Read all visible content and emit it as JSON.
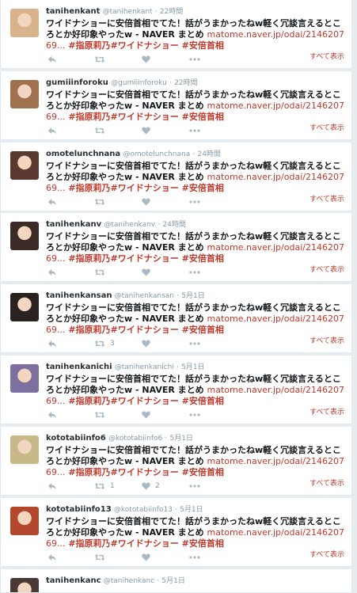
{
  "tweets": [
    {
      "name": "tanihenkant",
      "handle": "@tanihenkant",
      "sep": "·",
      "time": "22時間",
      "text": "ワイドナショーに安倍首相でてた！話がうまかったねw軽く冗談言えるところとか好印象やったw - NAVER まとめ ",
      "link": "matome.naver.jp/odai/214620769...",
      "tags": "#指原莉乃#ワイドナショー #安倍首相",
      "retweets": "",
      "likes": "",
      "show_all": "すべて表示",
      "avatar_color": "#d9b38c"
    },
    {
      "name": "gumiiinforoku",
      "handle": "@gumiiinforoku",
      "sep": "·",
      "time": "22時間",
      "text": "ワイドナショーに安倍首相でてた！話がうまかったねw軽く冗談言えるところとか好印象やったw - NAVER まとめ ",
      "link": "matome.naver.jp/odai/214620769...",
      "tags": "#指原莉乃#ワイドナショー #安倍首相",
      "retweets": "",
      "likes": "",
      "show_all": "すべて表示",
      "avatar_color": "#a0714f"
    },
    {
      "name": "omotelunchnana",
      "handle": "@omotelunchnana",
      "sep": "·",
      "time": "24時間",
      "text": "ワイドナショーに安倍首相でてた！話がうまかったねw軽く冗談言えるところとか好印象やったw - NAVER まとめ ",
      "link": "matome.naver.jp/odai/214620769...",
      "tags": "#指原莉乃#ワイドナショー #安倍首相",
      "retweets": "",
      "likes": "",
      "show_all": "すべて表示",
      "avatar_color": "#5a3a30"
    },
    {
      "name": "tanihenkanv",
      "handle": "@tanihenkanv",
      "sep": "·",
      "time": "24時間",
      "text": "ワイドナショーに安倍首相でてた！話がうまかったねw軽く冗談言えるところとか好印象やったw - NAVER まとめ ",
      "link": "matome.naver.jp/odai/214620769...",
      "tags": "#指原莉乃#ワイドナショー #安倍首相",
      "retweets": "",
      "likes": "",
      "show_all": "すべて表示",
      "avatar_color": "#3b2a25"
    },
    {
      "name": "tanihenkansan",
      "handle": "@tanihenkansan",
      "sep": "·",
      "time": "5月1日",
      "text": "ワイドナショーに安倍首相でてた！話がうまかったねw軽く冗談言えるところとか好印象やったw - NAVER まとめ ",
      "link": "matome.naver.jp/odai/214620769...",
      "tags": "#指原莉乃#ワイドナショー #安倍首相",
      "retweets": "3",
      "likes": "",
      "show_all": "すべて表示",
      "avatar_color": "#2a2220"
    },
    {
      "name": "tanihenkanichi",
      "handle": "@tanihenkanichi",
      "sep": "·",
      "time": "5月1日",
      "text": "ワイドナショーに安倍首相でてた！話がうまかったねw軽く冗談言えるところとか好印象やったw - NAVER まとめ ",
      "link": "matome.naver.jp/odai/214620769...",
      "tags": "#指原莉乃#ワイドナショー #安倍首相",
      "retweets": "",
      "likes": "",
      "show_all": "すべて表示",
      "avatar_color": "#7d6fa0"
    },
    {
      "name": "kototabiinfo6",
      "handle": "@kototabiinfo6",
      "sep": "·",
      "time": "5月1日",
      "text": "ワイドナショーに安倍首相でてた！話がうまかったねw軽く冗談言えるところとか好印象やったw - NAVER まとめ ",
      "link": "matome.naver.jp/odai/214620769...",
      "tags": "#指原莉乃#ワイドナショー #安倍首相",
      "retweets": "1",
      "likes": "2",
      "show_all": "すべて表示",
      "avatar_color": "#c9b98a"
    },
    {
      "name": "kototabiinfo13",
      "handle": "@kototabiinfo13",
      "sep": "·",
      "time": "5月1日",
      "text": "ワイドナショーに安倍首相でてた！話がうまかったねw軽く冗談言えるところとか好印象やったw - NAVER まとめ ",
      "link": "matome.naver.jp/odai/214620769...",
      "tags": "#指原莉乃#ワイドナショー #安倍首相",
      "retweets": "",
      "likes": "",
      "show_all": "すべて表示",
      "avatar_color": "#b5472e"
    },
    {
      "name": "tanihenkanc",
      "handle": "@tanihenkanc",
      "sep": "·",
      "time": "5月1日",
      "text": "",
      "link": "",
      "tags": "",
      "retweets": "",
      "likes": "",
      "show_all": "",
      "avatar_color": "#4a3a35"
    }
  ]
}
